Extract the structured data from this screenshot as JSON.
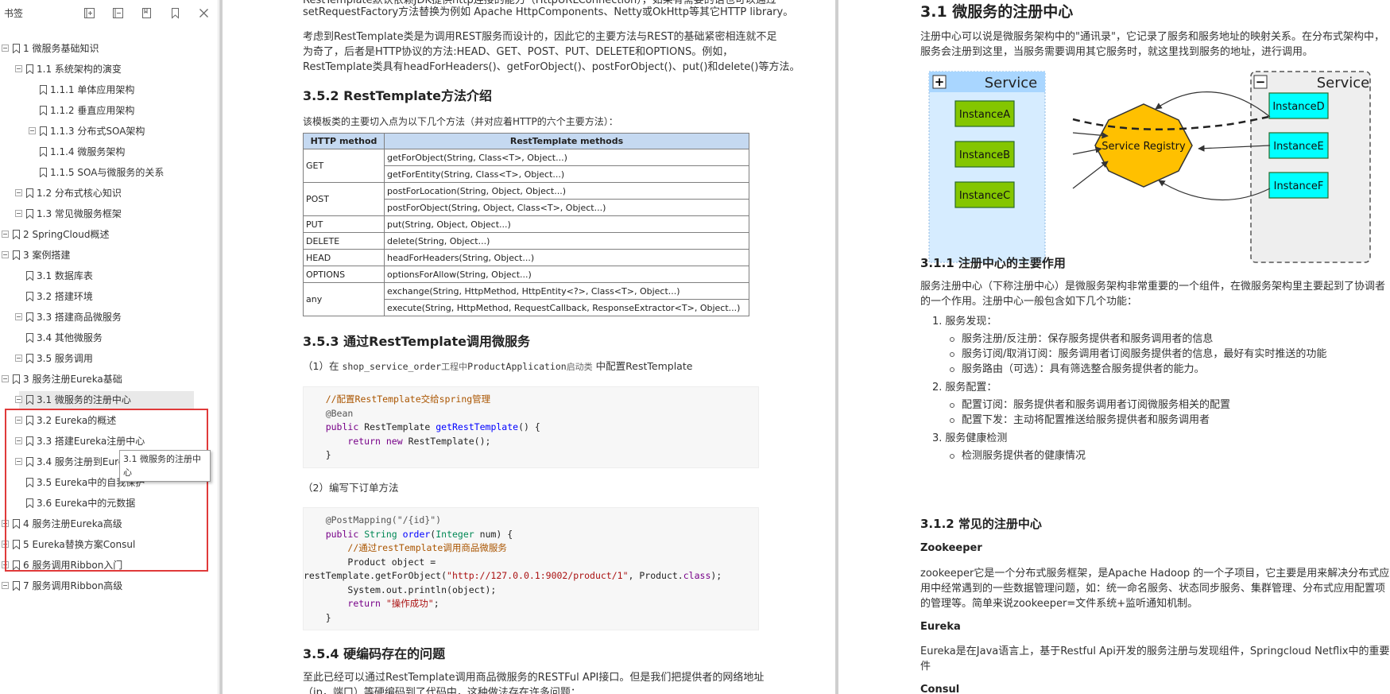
{
  "sidebar": {
    "title": "书签",
    "tools": [
      {
        "name": "expand-all-icon"
      },
      {
        "name": "collapse-all-icon"
      },
      {
        "name": "add-bookmark-icon"
      },
      {
        "name": "bookmark-icon"
      },
      {
        "name": "close-icon"
      }
    ],
    "items": [
      {
        "label": "1 微服务基础知识"
      },
      {
        "label": "1.1 系统架构的演变"
      },
      {
        "label": "1.1.1 单体应用架构"
      },
      {
        "label": "1.1.2 垂直应用架构"
      },
      {
        "label": "1.1.3 分布式SOA架构"
      },
      {
        "label": "1.1.4 微服务架构"
      },
      {
        "label": "1.1.5 SOA与微服务的关系"
      },
      {
        "label": "1.2 分布式核心知识"
      },
      {
        "label": "1.3 常见微服务框架"
      },
      {
        "label": "2 SpringCloud概述"
      },
      {
        "label": "3 案例搭建"
      },
      {
        "label": "3.1 数据库表"
      },
      {
        "label": "3.2 搭建环境"
      },
      {
        "label": "3.3 搭建商品微服务"
      },
      {
        "label": "3.4 其他微服务"
      },
      {
        "label": "3.5 服务调用"
      },
      {
        "label": "3 服务注册Eureka基础"
      },
      {
        "label": "3.1 微服务的注册中心"
      },
      {
        "label": "3.2 Eureka的概述"
      },
      {
        "label": "3.3 搭建Eureka注册中心"
      },
      {
        "label": "3.4 服务注册到Eureka注册中心"
      },
      {
        "label": "3.5 Eureka中的自我保护"
      },
      {
        "label": "3.6 Eureka中的元数据"
      },
      {
        "label": "4 服务注册Eureka高级"
      },
      {
        "label": "5 Eureka替换方案Consul"
      },
      {
        "label": "6 服务调用Ribbon入门"
      },
      {
        "label": "7 服务调用Ribbon高级"
      }
    ],
    "tooltip": "3.1 微服务的注册中心"
  },
  "page1": {
    "intro_lines": [
      "RestTemplate默认依赖JDK提供http连接的能力（HttpURLConnection），如果有需要的话也可以通过",
      "setRequestFactory方法替换为例如 Apache HttpComponents、Netty或OkHttp等其它HTTP library。"
    ],
    "para2_lines": [
      "考虑到RestTemplate类是为调用REST服务而设计的，因此它的主要方法与REST的基础紧密相连就不足",
      "为奇了，后者是HTTP协议的方法:HEAD、GET、POST、PUT、DELETE和OPTIONS。例如，",
      "RestTemplate类具有headForHeaders()、getForObject()、postForObject()、put()和delete()等方法。"
    ],
    "h_352": "3.5.2 RestTemplate方法介绍",
    "table_intro": "该模板类的主要切入点为以下几个方法（并对应着HTTP的六个主要方法）：",
    "table": {
      "headers": [
        "HTTP method",
        "RestTemplate methods"
      ],
      "groups": [
        {
          "method": "GET",
          "calls": [
            "getForObject(String, Class<T>, Object...)",
            "getForEntity(String, Class<T>, Object...)"
          ]
        },
        {
          "method": "POST",
          "calls": [
            "postForLocation(String, Object, Object...)",
            "postForObject(String, Object, Class<T>, Object...)"
          ]
        },
        {
          "method": "PUT",
          "calls": [
            "put(String, Object, Object...)"
          ]
        },
        {
          "method": "DELETE",
          "calls": [
            "delete(String, Object...)"
          ]
        },
        {
          "method": "HEAD",
          "calls": [
            "headForHeaders(String, Object...)"
          ]
        },
        {
          "method": "OPTIONS",
          "calls": [
            "optionsForAllow(String, Object...)"
          ]
        },
        {
          "method": "any",
          "calls": [
            "exchange(String, HttpMethod, HttpEntity<?>, Class<T>, Object...)",
            "execute(String, HttpMethod, RequestCallback, ResponseExtractor<T>, Object...)"
          ]
        }
      ]
    },
    "h_353": "3.5.3 通过RestTemplate调用微服务",
    "step1": {
      "prefix": "（1）在 ",
      "code1": "shop_service_order",
      "mid1": "工程中",
      "code2": "ProductApplication",
      "mid2": "启动类",
      "suffix": " 中配置RestTemplate"
    },
    "code1": {
      "comment": "//配置RestTemplate交给spring管理",
      "annotation": "@Bean",
      "kw_public": "public",
      "type": "RestTemplate",
      "method": "getRestTemplate",
      "sig_tail": "() {",
      "kw_return": "return",
      "kw_new": "new",
      "ctor": "RestTemplate();",
      "close": "}"
    },
    "step2": "（2）编写下订单方法",
    "code2": {
      "annotation": "@PostMapping(\"/{id}\")",
      "kw_public": "public",
      "ret_type": "String",
      "method": "order",
      "param_type": "Integer",
      "param": "num) {",
      "paren": "(",
      "comment": "//通过restTemplate调用商品微服务",
      "decl": "Product object =",
      "call": "restTemplate.getForObject(",
      "url": "\"http://127.0.0.1:9002/product/1\"",
      "call_tail": ", Product.",
      "kw_class": "class",
      "call_end": ");",
      "print": "System.out.println(object);",
      "kw_return": "return",
      "ret_str": "\"操作成功\"",
      "semi": ";",
      "close": "}"
    },
    "h_354": "3.5.4 硬编码存在的问题",
    "tail_lines": [
      "至此已经可以通过RestTemplate调用商品微服务的RESTFul API接口。但是我们把提供者的网络地址",
      "（ip，端口）等硬编码到了代码中，这种做法存在许多问题："
    ]
  },
  "page2": {
    "h_31": "3.1 微服务的注册中心",
    "p1_lines": [
      "注册中心可以说是微服务架构中的\"通讯录\"，它记录了服务和服务地址的映射关系。在分布式架构中，",
      "服务会注册到这里，当服务需要调用其它服务时，就这里找到服务的地址，进行调用。"
    ],
    "diagram": {
      "left_group": "Service",
      "right_group": "Service",
      "left_toggle": "+",
      "right_toggle": "−",
      "registry": "Service Registry",
      "left_instances": [
        "InstanceA",
        "InstanceB",
        "InstanceC"
      ],
      "right_instances": [
        "InstanceD",
        "InstanceE",
        "InstanceF"
      ],
      "colors": {
        "left_bg": "#d6ecff",
        "right_bg": "#eeeeee",
        "green": "#84c600",
        "cyan": "#00ffff",
        "registry": "#ffc000",
        "header": "#a9d6ff"
      }
    },
    "h_311": "3.1.1 注册中心的主要作用",
    "p2_lines": [
      "服务注册中心（下称注册中心）是微服务架构非常重要的一个组件，在微服务架构里主要起到了协调者",
      "的一个作用。注册中心一般包含如下几个功能："
    ],
    "list": [
      {
        "num": "1.",
        "title": "服务发现：",
        "bullets": [
          "服务注册/反注册：保存服务提供者和服务调用者的信息",
          "服务订阅/取消订阅：服务调用者订阅服务提供者的信息，最好有实时推送的功能",
          "服务路由（可选）：具有筛选整合服务提供者的能力。"
        ]
      },
      {
        "num": "2.",
        "title": "服务配置：",
        "bullets": [
          "配置订阅：服务提供者和服务调用者订阅微服务相关的配置",
          "配置下发：主动将配置推送给服务提供者和服务调用者"
        ]
      },
      {
        "num": "3.",
        "title": "服务健康检测",
        "bullets": [
          "检测服务提供者的健康情况"
        ]
      }
    ],
    "h_312": "3.1.2 常见的注册中心",
    "zk_title": "Zookeeper",
    "zk_lines": [
      "zookeeper它是一个分布式服务框架，是Apache Hadoop 的一个子项目，它主要是用来解决分布式应",
      "用中经常遇到的一些数据管理问题，如：统一命名服务、状态同步服务、集群管理、分布式应用配置项",
      "的管理等。简单来说zookeeper=文件系统+监听通知机制。"
    ],
    "eureka_title": "Eureka",
    "eureka_lines": [
      "Eureka是在Java语言上，基于Restful Api开发的服务注册与发现组件，Springcloud Netflix中的重要组",
      "件"
    ],
    "consul_title": "Consul"
  }
}
